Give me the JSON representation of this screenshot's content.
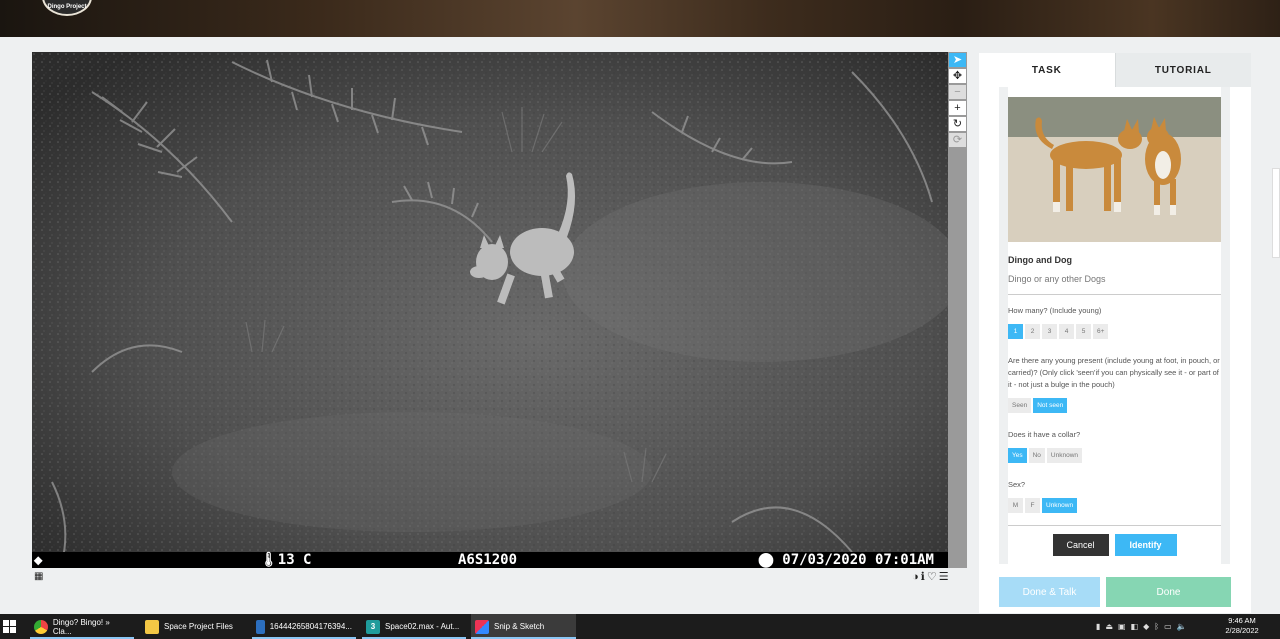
{
  "header": {
    "logo_text": "Dingo Project"
  },
  "viewer": {
    "camera_brand": "⬥",
    "temperature": "🌡13 C",
    "camera_model": "A6S1200",
    "timestamp": "⬤ 07/03/2020  07:01AM"
  },
  "toolbar": {
    "tools": [
      "select-icon",
      "move-icon",
      "zoom-out-icon",
      "zoom-in-icon",
      "rotate-icon",
      "reset-icon"
    ]
  },
  "task_panel": {
    "tabs": {
      "task": "TASK",
      "tutorial": "TUTORIAL"
    },
    "species": {
      "name": "Dingo and Dog",
      "description": "Dingo or any other Dogs"
    },
    "questions": {
      "count": {
        "label": "How many? (Include young)",
        "options": [
          "1",
          "2",
          "3",
          "4",
          "5",
          "6+"
        ],
        "selected": "1"
      },
      "young": {
        "label": "Are there any young present (include young at foot, in pouch, or carried)? (Only click 'seen'if you can physically see it - or part of it - not just a bulge in the pouch)",
        "options": [
          "Seen",
          "Not seen"
        ],
        "selected": "Not seen"
      },
      "collar": {
        "label": "Does it have a collar?",
        "options": [
          "Yes",
          "No",
          "Unknown"
        ],
        "selected": "Yes"
      },
      "sex": {
        "label": "Sex?",
        "options": [
          "M",
          "F",
          "Unknown"
        ],
        "selected": "Unknown"
      }
    },
    "cancel_label": "Cancel",
    "identify_label": "Identify"
  },
  "footer": {
    "done_talk_label": "Done & Talk",
    "done_label": "Done"
  },
  "taskbar": {
    "apps": [
      {
        "label": "Dingo? Bingo! » Cla...",
        "icon": "chrome-icon"
      },
      {
        "label": "Space Project Files",
        "icon": "folder-icon"
      },
      {
        "label": "16444265804176394...",
        "icon": "image-icon"
      },
      {
        "label": "Space02.max - Aut...",
        "icon": "3dsmax-icon"
      },
      {
        "label": "Snip & Sketch",
        "icon": "snip-icon"
      }
    ],
    "time": "9:46 AM",
    "date": "2/28/2022"
  },
  "colors": {
    "accent": "#3db8f5",
    "done": "#86d6b3",
    "done_talk": "#a7dcf7",
    "cancel": "#333333"
  }
}
